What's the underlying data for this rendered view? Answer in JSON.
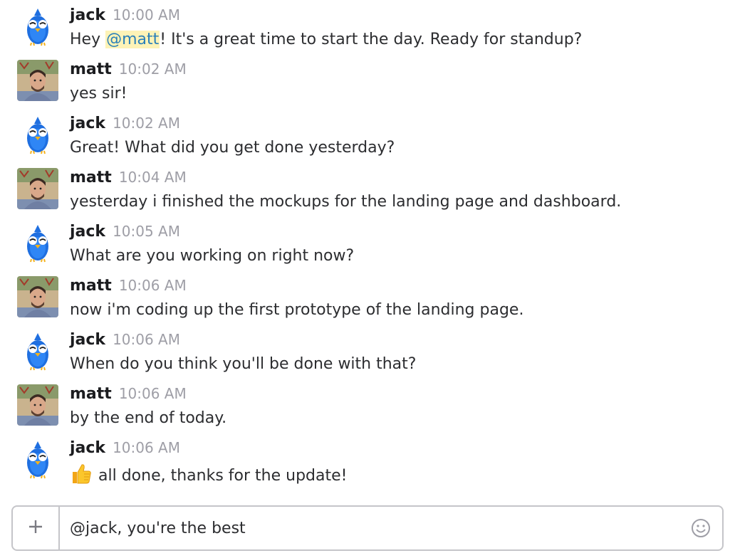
{
  "messages": [
    {
      "author": "jack",
      "time": "10:00 AM",
      "avatar": "bird-icon",
      "pre": "Hey ",
      "mention": "@matt",
      "post": "! It's a great time to start the day. Ready for standup?"
    },
    {
      "author": "matt",
      "time": "10:02 AM",
      "avatar": "user-photo",
      "text": "yes sir!"
    },
    {
      "author": "jack",
      "time": "10:02 AM",
      "avatar": "bird-icon",
      "text": "Great! What did you get done yesterday?"
    },
    {
      "author": "matt",
      "time": "10:04 AM",
      "avatar": "user-photo",
      "text": "yesterday i finished the mockups for the landing page and dashboard."
    },
    {
      "author": "jack",
      "time": "10:05 AM",
      "avatar": "bird-icon",
      "text": "What are you working on right now?"
    },
    {
      "author": "matt",
      "time": "10:06 AM",
      "avatar": "user-photo",
      "text": "now i'm coding up the first prototype of the landing page."
    },
    {
      "author": "jack",
      "time": "10:06 AM",
      "avatar": "bird-icon",
      "text": "When do you think you'll be done with that?"
    },
    {
      "author": "matt",
      "time": "10:06 AM",
      "avatar": "user-photo",
      "text": "by the end of today."
    },
    {
      "author": "jack",
      "time": "10:06 AM",
      "avatar": "bird-icon",
      "emoji": "thumbs-up-icon",
      "text": "all done, thanks for the update!"
    }
  ],
  "composer": {
    "value": "@jack, you're the best",
    "plus_icon": "plus-icon",
    "emoji_icon": "smiley-icon"
  },
  "colors": {
    "mention_bg": "#fdf3b7",
    "mention_text": "#2a80b9",
    "bird_blue": "#1f6fe0",
    "timestamp": "#9e9ea6"
  }
}
